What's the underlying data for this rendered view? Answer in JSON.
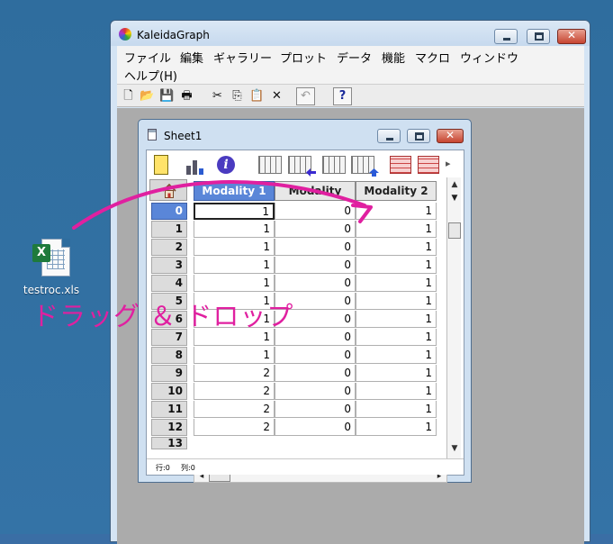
{
  "desktop": {
    "file_icon": {
      "name": "testroc.xls",
      "icon": "excel-file-icon"
    }
  },
  "app": {
    "title": "KaleidaGraph",
    "menu": [
      "ファイル",
      "編集",
      "ギャラリー",
      "プロット",
      "データ",
      "機能",
      "マクロ",
      "ウィンドウ",
      "ヘルプ(H)"
    ],
    "toolbar": [
      "new-icon",
      "open-icon",
      "save-icon",
      "print-icon",
      "cut-icon",
      "copy-icon",
      "paste-icon",
      "clear-icon",
      "undo-icon",
      "help-icon"
    ],
    "help_label": "?",
    "clear_label": "✕"
  },
  "sheet": {
    "title": "Sheet1",
    "columns": [
      "Modality 1",
      "Modality",
      "Modality 2"
    ],
    "rows": [
      {
        "index": "0",
        "c1": "1",
        "c2": "0",
        "c3": "1"
      },
      {
        "index": "1",
        "c1": "1",
        "c2": "0",
        "c3": "1"
      },
      {
        "index": "2",
        "c1": "1",
        "c2": "0",
        "c3": "1"
      },
      {
        "index": "3",
        "c1": "1",
        "c2": "0",
        "c3": "1"
      },
      {
        "index": "4",
        "c1": "1",
        "c2": "0",
        "c3": "1"
      },
      {
        "index": "5",
        "c1": "1",
        "c2": "0",
        "c3": "1"
      },
      {
        "index": "6",
        "c1": "1",
        "c2": "0",
        "c3": "1"
      },
      {
        "index": "7",
        "c1": "1",
        "c2": "0",
        "c3": "1"
      },
      {
        "index": "8",
        "c1": "1",
        "c2": "0",
        "c3": "1"
      },
      {
        "index": "9",
        "c1": "2",
        "c2": "0",
        "c3": "1"
      },
      {
        "index": "10",
        "c1": "2",
        "c2": "0",
        "c3": "1"
      },
      {
        "index": "11",
        "c1": "2",
        "c2": "0",
        "c3": "1"
      },
      {
        "index": "12",
        "c1": "2",
        "c2": "0",
        "c3": "1"
      }
    ],
    "partial_row": "13",
    "status": {
      "row": "行:0",
      "col": "列:0"
    }
  },
  "annotation": {
    "text": "ドラッグ ＆ ドロップ",
    "color": "#e020a0"
  },
  "colors": {
    "accent": "#5a86d8",
    "annotation": "#e020a0"
  }
}
